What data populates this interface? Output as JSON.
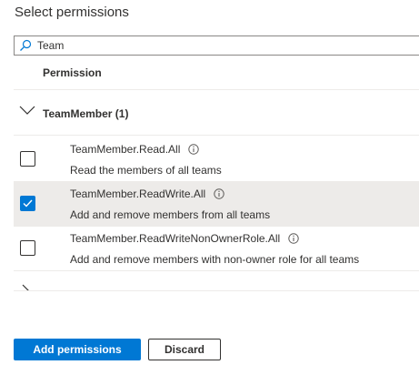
{
  "panel": {
    "title": "Select permissions"
  },
  "search": {
    "value": "Team",
    "placeholder": ""
  },
  "table": {
    "column_header": "Permission"
  },
  "group": {
    "label": "TeamMember (1)",
    "expanded": true,
    "permissions": [
      {
        "name": "TeamMember.Read.All",
        "description": "Read the members of all teams",
        "checked": false
      },
      {
        "name": "TeamMember.ReadWrite.All",
        "description": "Add and remove members from all teams",
        "checked": true
      },
      {
        "name": "TeamMember.ReadWriteNonOwnerRole.All",
        "description": "Add and remove members with non-owner role for all teams",
        "checked": false
      }
    ]
  },
  "footer": {
    "add_label": "Add permissions",
    "discard_label": "Discard"
  },
  "colors": {
    "accent": "#0078d4",
    "selected_row": "#edebe9",
    "divider": "#edebe9"
  },
  "icons": {
    "search": "search-icon",
    "info": "info-icon",
    "expand": "chevron-down-icon",
    "collapsed": "chevron-right-icon",
    "check": "checkmark-icon"
  }
}
